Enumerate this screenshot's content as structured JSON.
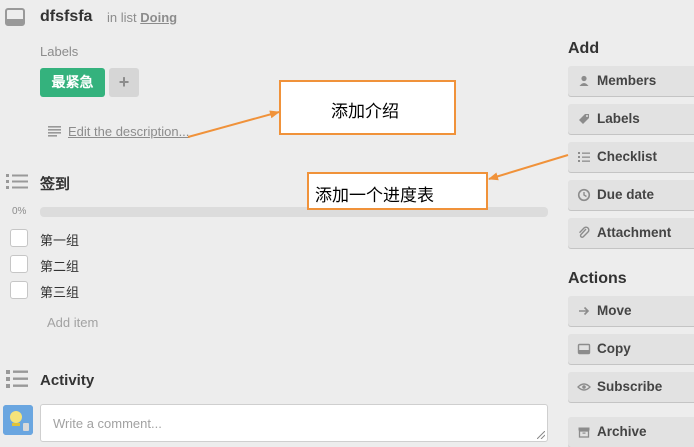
{
  "card": {
    "title": "dfsfsfa",
    "in_list_prefix": "in list",
    "list_name": "Doing",
    "labels_heading": "Labels",
    "label_name": "最紧急",
    "label_color": "#34b27d",
    "add_label_symbol": "+",
    "description_link": "Edit the description..."
  },
  "checklist": {
    "title": "签到",
    "progress_label": "0%",
    "progress_fraction": 0,
    "items": [
      {
        "label": "第一组",
        "checked": false
      },
      {
        "label": "第二组",
        "checked": false
      },
      {
        "label": "第三组",
        "checked": false
      }
    ],
    "add_item_label": "Add item"
  },
  "activity": {
    "title": "Activity",
    "comment_placeholder": "Write a comment..."
  },
  "sidebar": {
    "add_heading": "Add",
    "add_buttons": [
      {
        "label": "Members",
        "icon": "person-icon"
      },
      {
        "label": "Labels",
        "icon": "tag-icon"
      },
      {
        "label": "Checklist",
        "icon": "checklist-icon"
      },
      {
        "label": "Due date",
        "icon": "clock-icon"
      },
      {
        "label": "Attachment",
        "icon": "paperclip-icon"
      }
    ],
    "actions_heading": "Actions",
    "action_buttons": [
      {
        "label": "Move",
        "icon": "arrow-right-icon"
      },
      {
        "label": "Copy",
        "icon": "card-copy-icon"
      },
      {
        "label": "Subscribe",
        "icon": "eye-icon"
      },
      {
        "label": "Archive",
        "icon": "archive-icon"
      }
    ]
  },
  "annotations": {
    "description_note": "添加介绍",
    "checklist_note": "添加一个进度表",
    "accent_color": "#f0923a"
  }
}
